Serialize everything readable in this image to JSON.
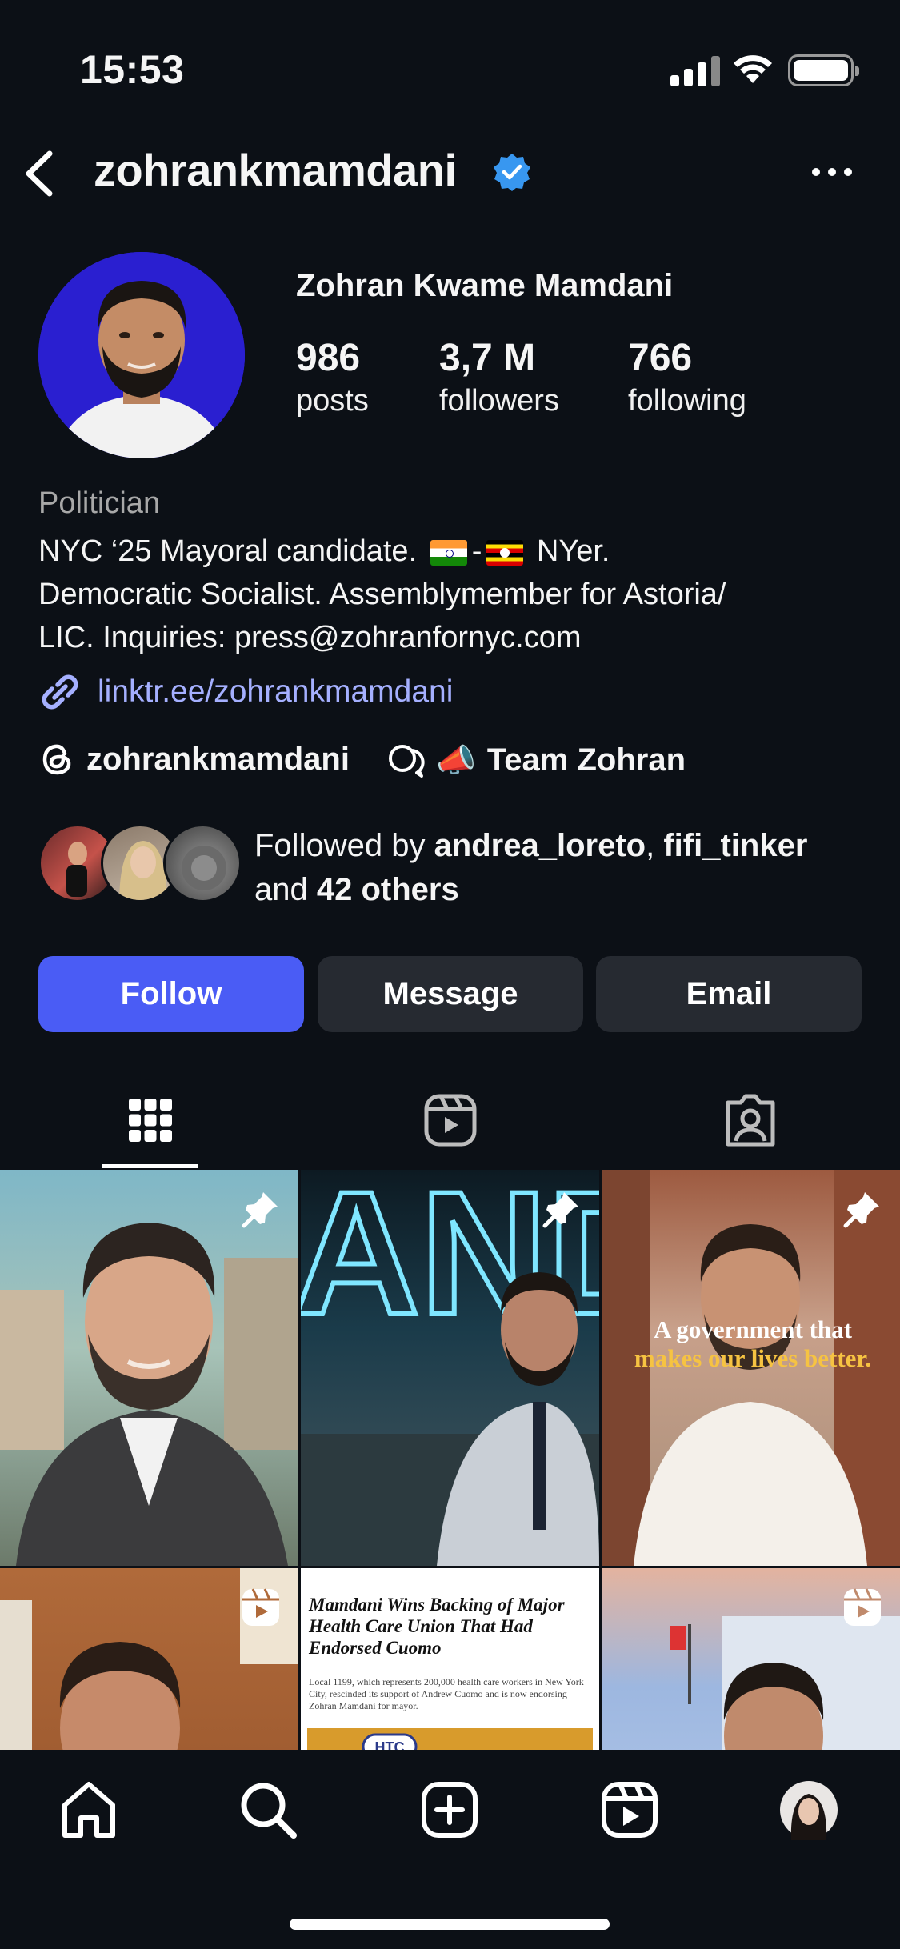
{
  "status_bar": {
    "time": "15:53"
  },
  "header": {
    "username": "zohrankmamdani"
  },
  "profile": {
    "full_name": "Zohran Kwame Mamdani",
    "stats": [
      {
        "value": "986",
        "label": "posts"
      },
      {
        "value": "3,7 M",
        "label": "followers"
      },
      {
        "value": "766",
        "label": "following"
      }
    ],
    "category": "Politician",
    "bio": {
      "line1_start": "NYC ‘25 Mayoral candidate.",
      "line1_dash": "-",
      "line1_end": "NYer.",
      "line2": "Democratic Socialist. Assemblymember for Astoria/",
      "line3": "LIC. Inquiries: press@zohranfornyc.com"
    },
    "link": "linktr.ee/zohrankmamdani",
    "threads_handle": "zohrankmamdani",
    "channel_name": "Team Zohran",
    "followed_by": {
      "prefix": "Followed by",
      "user1": "andrea_loreto",
      "separator": ",",
      "user2": "fifi_tinker",
      "and": "and",
      "others": "42 others"
    }
  },
  "actions": {
    "follow": "Follow",
    "message": "Message",
    "email": "Email"
  },
  "tabs": [
    {
      "name": "grid",
      "icon": "grid-icon",
      "active": true
    },
    {
      "name": "reels",
      "icon": "reels-icon",
      "active": false
    },
    {
      "name": "tagged",
      "icon": "tagged-icon",
      "active": false
    }
  ],
  "posts": {
    "tile3_caption_line1": "A government that",
    "tile3_caption_line2": "makes our lives better.",
    "tile2_sign": "AND",
    "news_headline": "Mamdani Wins Backing of Major Health Care Union That Had Endorsed Cuomo",
    "news_sub": "Local 1199, which represents 200,000 health care workers in New York City, rescinded its support of Andrew Cuomo and is now endorsing Zohran Mamdani for mayor.",
    "news_logo": "HTC"
  },
  "colors": {
    "background": "#0c1016",
    "follow_button": "#4a5cf5",
    "secondary_button": "#262a31",
    "link": "#a5b0ff",
    "verified": "#3897f0"
  }
}
